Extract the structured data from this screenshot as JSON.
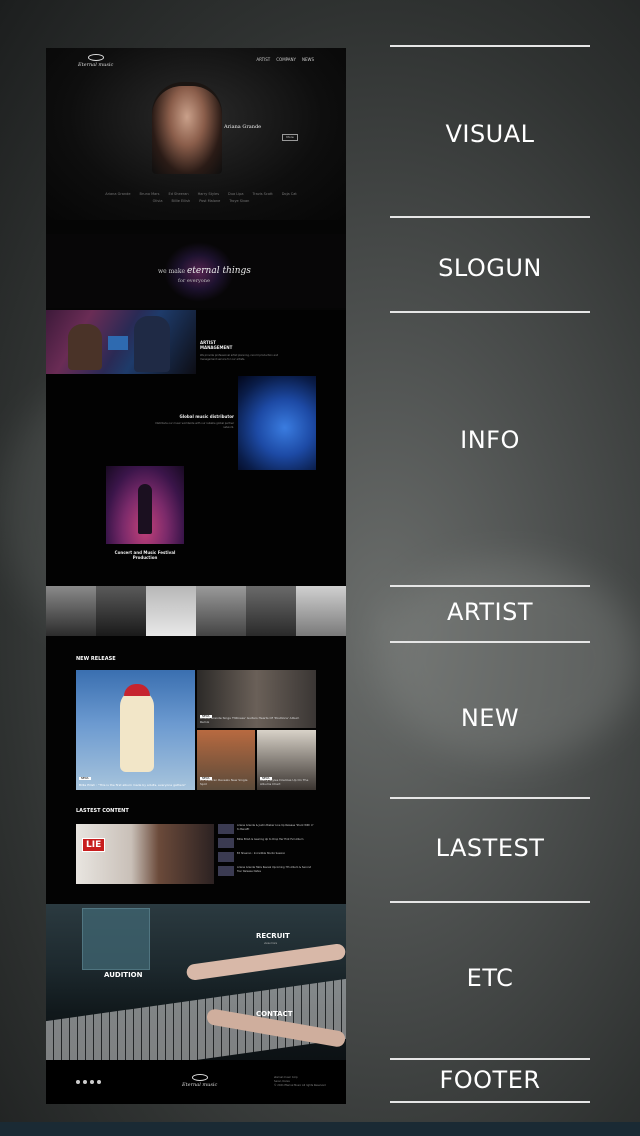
{
  "site": {
    "logo": "Eternal music",
    "nav": [
      "ARTIST",
      "COMPANY",
      "NEWS"
    ],
    "visual": {
      "artist_name": "Ariana Grande",
      "more_label": "More",
      "artist_list": [
        "Ariana Grande",
        "Bruno Mars",
        "Ed Sheeran",
        "Harry Styles",
        "Dua Lipa",
        "Travis Scott",
        "Doja Cat",
        "Olivia",
        "Billie Eilish",
        "Post Malone",
        "Troye Sivan"
      ]
    },
    "slogun": {
      "line1_prefix": "we make",
      "line1_emphasis": "eternal things",
      "line2": "for everyone"
    },
    "info": {
      "block1_title": "ARTIST MANAGEMENT",
      "block1_text": "We provide professional artist planning, record production and management service for our artists.",
      "block2_title": "Global music distributor",
      "block2_text": "Distribute our music worldwide with our reliable global partner network.",
      "block3_title": "Concert and Music Festival Production"
    },
    "new_release": {
      "title": "NEW RELEASE",
      "main_tag": "NEWS",
      "main_caption": "Billie Eilish : \"This is the first album made by adults, everyone gathers\"",
      "tiles": [
        {
          "tag": "NEWS",
          "caption": "Ariana Grande Sings 'Hilliness' Guitars Hearts Of 'Positions' Album Remix"
        },
        {
          "tag": "NEWS",
          "caption": "Ed Sheeran Reveals New Single Spot"
        },
        {
          "tag": "NEWS",
          "caption": "Harry Styles Doubles Up On The Albums Chart"
        }
      ]
    },
    "latest": {
      "title": "LASTEST CONTENT",
      "main_label": "LIE",
      "items": [
        "Ariana Grande & Justin Bieber Line Up Release 'Stuck With U' to Benefit",
        "Billie Eilish Is Gearing Up to Drop Her First Full Album",
        "Ed Sheeran : Incredible Studio Session",
        "Ariana Grande Talks Reveal Upcoming 7th Album & Second Tour Release Dates"
      ]
    },
    "etc": {
      "recruit": "RECRUIT",
      "recruit_sub": "view more",
      "audition": "AUDITION",
      "contact": "CONTACT"
    },
    "footer": {
      "logo": "Eternal music",
      "info_line1": "eternal music Corp",
      "info_line2": "Seoul, Korea",
      "info_line3": "© 2021 Eternal Music All rights Reserved"
    }
  },
  "section_map": [
    "VISUAL",
    "SLOGUN",
    "INFO",
    "ARTIST",
    "NEW",
    "LASTEST",
    "ETC",
    "FOOTER"
  ]
}
